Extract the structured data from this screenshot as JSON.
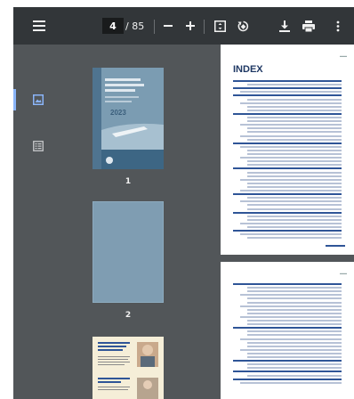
{
  "toolbar": {
    "current_page": "4",
    "page_total": "/ 85",
    "icons": [
      "menu-icon",
      "zoom-out-icon",
      "zoom-in-icon",
      "fit-page-icon",
      "rotate-icon",
      "download-icon",
      "print-icon",
      "more-vert-icon"
    ]
  },
  "thumbnails": [
    {
      "label": "1",
      "year": "2023"
    },
    {
      "label": "2"
    },
    {
      "label": ""
    }
  ],
  "document": {
    "index_title": "INDEX"
  },
  "colors": {
    "toolbar_bg": "#323639",
    "viewer_bg": "#525659",
    "accent": "#8ab4f8",
    "index_title": "#1f3864"
  }
}
